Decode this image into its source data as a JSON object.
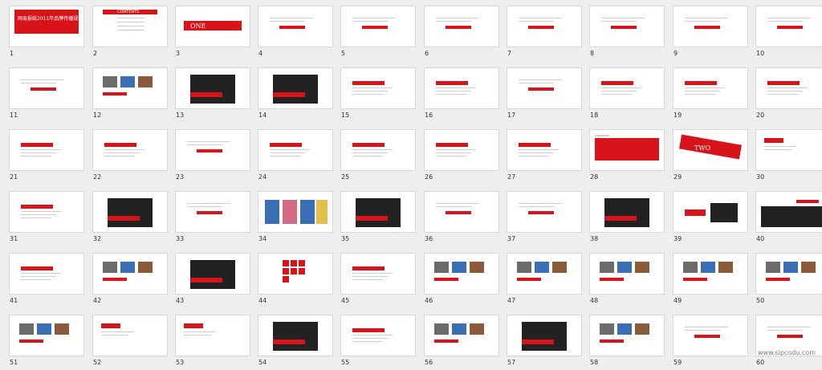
{
  "slides": [
    {
      "number": "1",
      "caption": "网易报纸2011年品牌传播规划"
    },
    {
      "number": "2",
      "caption": "CONTENTS"
    },
    {
      "number": "3",
      "caption": "ONE"
    },
    {
      "number": "4",
      "caption": ""
    },
    {
      "number": "5",
      "caption": ""
    },
    {
      "number": "6",
      "caption": ""
    },
    {
      "number": "7",
      "caption": ""
    },
    {
      "number": "8",
      "caption": ""
    },
    {
      "number": "9",
      "caption": ""
    },
    {
      "number": "10",
      "caption": ""
    },
    {
      "number": "11",
      "caption": ""
    },
    {
      "number": "12",
      "caption": ""
    },
    {
      "number": "13",
      "caption": ""
    },
    {
      "number": "14",
      "caption": ""
    },
    {
      "number": "15",
      "caption": ""
    },
    {
      "number": "16",
      "caption": ""
    },
    {
      "number": "17",
      "caption": ""
    },
    {
      "number": "18",
      "caption": ""
    },
    {
      "number": "19",
      "caption": ""
    },
    {
      "number": "20",
      "caption": ""
    },
    {
      "number": "21",
      "caption": ""
    },
    {
      "number": "22",
      "caption": ""
    },
    {
      "number": "23",
      "caption": ""
    },
    {
      "number": "24",
      "caption": ""
    },
    {
      "number": "25",
      "caption": ""
    },
    {
      "number": "26",
      "caption": ""
    },
    {
      "number": "27",
      "caption": ""
    },
    {
      "number": "28",
      "caption": ""
    },
    {
      "number": "29",
      "caption": "TWO"
    },
    {
      "number": "30",
      "caption": ""
    },
    {
      "number": "31",
      "caption": ""
    },
    {
      "number": "32",
      "caption": ""
    },
    {
      "number": "33",
      "caption": ""
    },
    {
      "number": "34",
      "caption": ""
    },
    {
      "number": "35",
      "caption": ""
    },
    {
      "number": "36",
      "caption": ""
    },
    {
      "number": "37",
      "caption": ""
    },
    {
      "number": "38",
      "caption": ""
    },
    {
      "number": "39",
      "caption": ""
    },
    {
      "number": "40",
      "caption": ""
    },
    {
      "number": "41",
      "caption": ""
    },
    {
      "number": "42",
      "caption": ""
    },
    {
      "number": "43",
      "caption": ""
    },
    {
      "number": "44",
      "caption": ""
    },
    {
      "number": "45",
      "caption": ""
    },
    {
      "number": "46",
      "caption": ""
    },
    {
      "number": "47",
      "caption": ""
    },
    {
      "number": "48",
      "caption": ""
    },
    {
      "number": "49",
      "caption": ""
    },
    {
      "number": "50",
      "caption": ""
    },
    {
      "number": "51",
      "caption": ""
    },
    {
      "number": "52",
      "caption": ""
    },
    {
      "number": "53",
      "caption": ""
    },
    {
      "number": "54",
      "caption": ""
    },
    {
      "number": "55",
      "caption": ""
    },
    {
      "number": "56",
      "caption": ""
    },
    {
      "number": "57",
      "caption": ""
    },
    {
      "number": "58",
      "caption": ""
    },
    {
      "number": "59",
      "caption": ""
    },
    {
      "number": "60",
      "caption": ""
    }
  ],
  "watermark": "www.sipcodu.com"
}
